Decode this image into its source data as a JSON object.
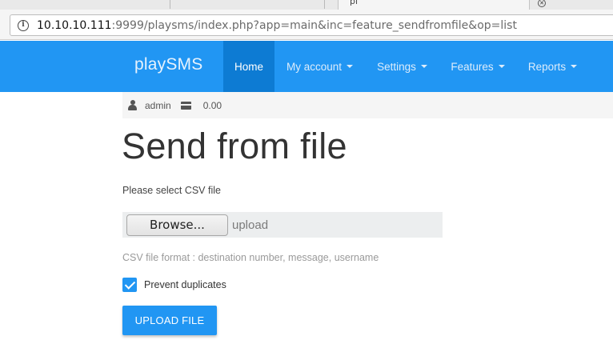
{
  "browser": {
    "active_tab_fragment": "pl",
    "address": {
      "host": "10.10.10.111",
      "rest": ":9999/playsms/index.php?app=main&inc=feature_sendfromfile&op=list"
    }
  },
  "navbar": {
    "brand": "playSMS",
    "items": [
      {
        "label": "Home",
        "active": true,
        "dropdown": false
      },
      {
        "label": "My account",
        "active": false,
        "dropdown": true
      },
      {
        "label": "Settings",
        "active": false,
        "dropdown": true
      },
      {
        "label": "Features",
        "active": false,
        "dropdown": true
      },
      {
        "label": "Reports",
        "active": false,
        "dropdown": true
      }
    ],
    "color": "#2196f3",
    "active_color": "#0d7bd3"
  },
  "status": {
    "user": "admin",
    "credit": "0.00"
  },
  "main": {
    "title": "Send from file",
    "prompt": "Please select CSV file",
    "browse_label": "Browse...",
    "file_placeholder": "upload",
    "help": "CSV file format : destination number, message, username",
    "prevent_duplicates_label": "Prevent duplicates",
    "prevent_duplicates_checked": true,
    "upload_label": "UPLOAD FILE"
  }
}
